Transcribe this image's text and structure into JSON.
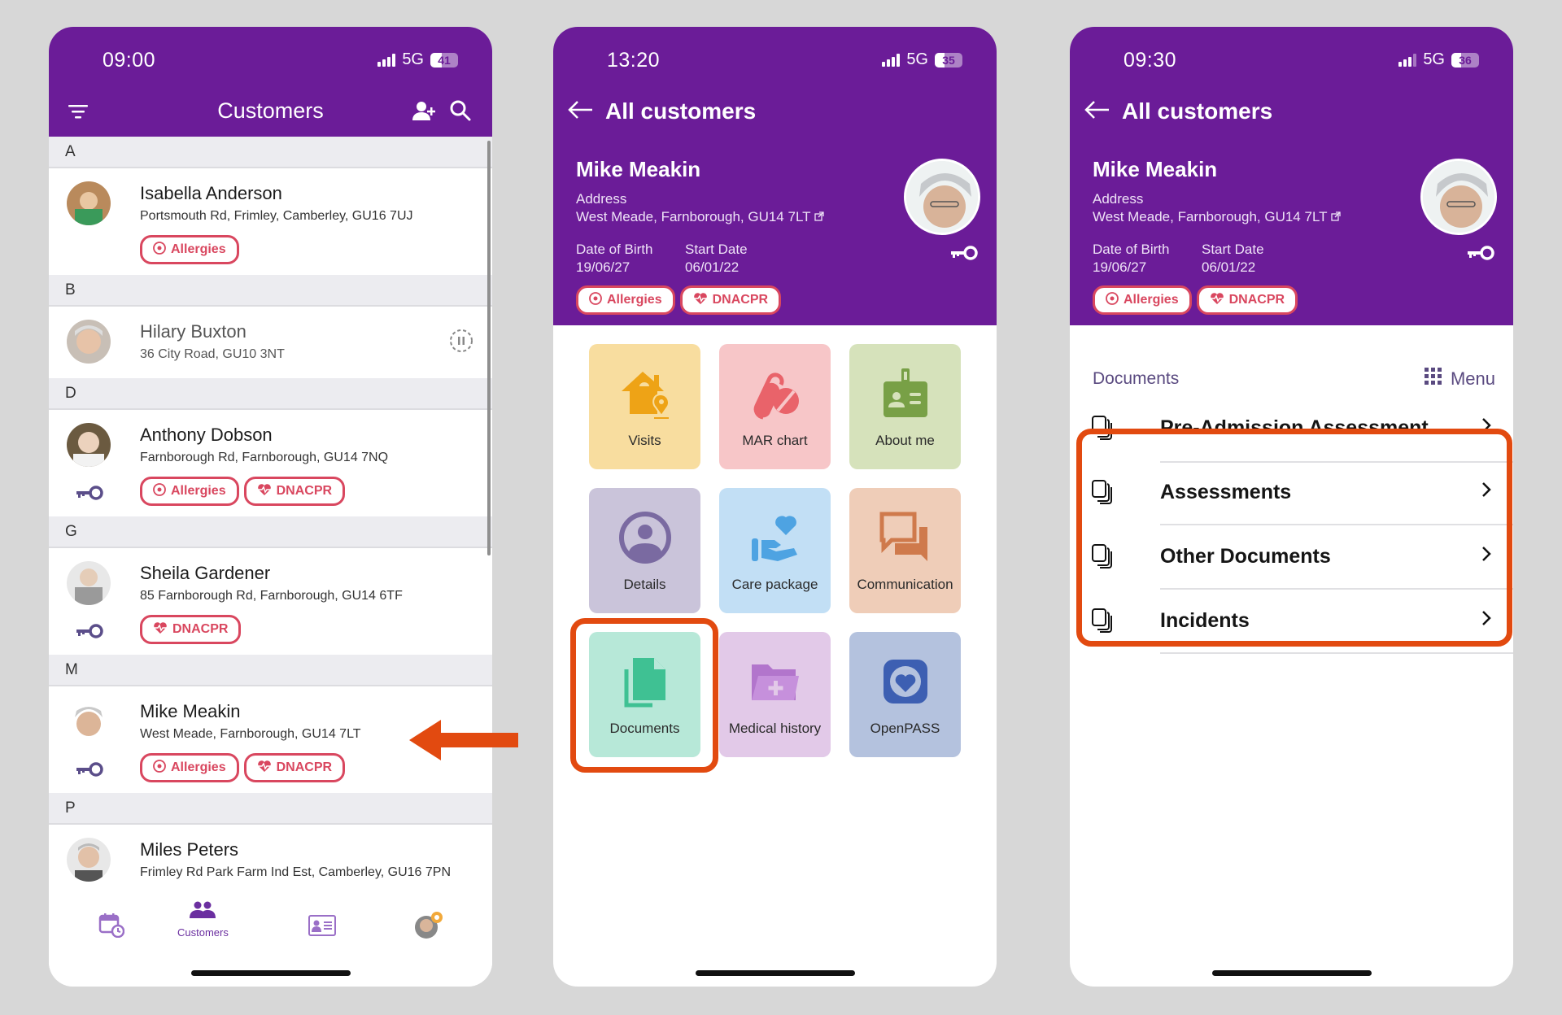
{
  "colors": {
    "brand_purple": "#6b1c98",
    "alert_red": "#d9475f",
    "annotation_orange": "#e24a10",
    "background": "#d7d7d7"
  },
  "screens": {
    "customers_list": {
      "status": {
        "time": "09:00",
        "network": "5G",
        "battery": "41",
        "battery_level": 0.41
      },
      "header": {
        "title": "Customers",
        "filter_icon": "filter-icon",
        "add_icon": "add-user-icon",
        "search_icon": "search-icon"
      },
      "sections": [
        {
          "letter": "A",
          "customers": [
            {
              "name": "Isabella Anderson",
              "address": "Portsmouth Rd, Frimley, Camberley, GU16 7UJ",
              "tags": [
                "Allergies"
              ],
              "key": false,
              "paused": false
            }
          ]
        },
        {
          "letter": "B",
          "customers": [
            {
              "name": "Hilary Buxton",
              "address": "36 City Road, GU10 3NT",
              "tags": [],
              "key": false,
              "paused": true
            }
          ]
        },
        {
          "letter": "D",
          "customers": [
            {
              "name": "Anthony Dobson",
              "address": "Farnborough Rd, Farnborough, GU14 7NQ",
              "tags": [
                "Allergies",
                "DNACPR"
              ],
              "key": true,
              "paused": false
            }
          ]
        },
        {
          "letter": "G",
          "customers": [
            {
              "name": "Sheila Gardener",
              "address": "85 Farnborough Rd, Farnborough, GU14 6TF",
              "tags": [
                "DNACPR"
              ],
              "key": true,
              "paused": false
            }
          ]
        },
        {
          "letter": "M",
          "customers": [
            {
              "name": "Mike Meakin",
              "address": "West Meade, Farnborough, GU14 7LT",
              "tags": [
                "Allergies",
                "DNACPR"
              ],
              "key": true,
              "paused": false
            }
          ]
        },
        {
          "letter": "P",
          "customers": [
            {
              "name": "Miles Peters",
              "address": "Frimley Rd Park Farm Ind Est, Camberley, GU16 7PN",
              "tags": [],
              "key": false,
              "paused": false
            }
          ]
        }
      ],
      "bottom_nav": [
        {
          "icon": "calendar-clock-icon",
          "label": "",
          "active": false
        },
        {
          "icon": "customers-icon",
          "label": "Customers",
          "active": true
        },
        {
          "icon": "id-card-icon",
          "label": "",
          "active": false
        },
        {
          "icon": "profile-avatar-icon",
          "label": "",
          "active": false
        }
      ]
    },
    "customer_menu": {
      "status": {
        "time": "13:20",
        "network": "5G",
        "battery": "35",
        "battery_level": 0.35
      },
      "back_label": "All customers",
      "profile": {
        "name": "Mike Meakin",
        "address_label": "Address",
        "address": "West Meade, Farnborough, GU14 7LT",
        "dob_label": "Date of Birth",
        "dob": "19/06/27",
        "start_label": "Start Date",
        "start": "06/01/22",
        "tags": [
          "Allergies",
          "DNACPR"
        ]
      },
      "tiles": [
        {
          "label": "Visits",
          "icon": "house-location-icon",
          "bg": "#f8dd9f",
          "fg": "#eea316"
        },
        {
          "label": "MAR chart",
          "icon": "pill-icon",
          "bg": "#f7c6c8",
          "fg": "#e9636a"
        },
        {
          "label": "About me",
          "icon": "id-badge-icon",
          "bg": "#d6e2bb",
          "fg": "#78a046"
        },
        {
          "label": "Details",
          "icon": "user-circle-icon",
          "bg": "#cac4da",
          "fg": "#7a6aa1"
        },
        {
          "label": "Care package",
          "icon": "hand-heart-icon",
          "bg": "#c2dff5",
          "fg": "#4ea3e2"
        },
        {
          "label": "Communication",
          "icon": "chat-icon",
          "bg": "#efcdb8",
          "fg": "#cf7a4c"
        },
        {
          "label": "Documents",
          "icon": "documents-icon",
          "bg": "#b7e8d8",
          "fg": "#3fc193"
        },
        {
          "label": "Medical history",
          "icon": "medical-folder-icon",
          "bg": "#e2c9e8",
          "fg": "#b275cc"
        },
        {
          "label": "OpenPASS",
          "icon": "openpass-heart-icon",
          "bg": "#b4c2de",
          "fg": "#3d5fb2"
        }
      ],
      "highlighted_tile": "Documents"
    },
    "documents": {
      "status": {
        "time": "09:30",
        "network": "5G",
        "battery": "36",
        "battery_level": 0.36
      },
      "back_label": "All customers",
      "profile": {
        "name": "Mike Meakin",
        "address_label": "Address",
        "address": "West Meade, Farnborough, GU14 7LT",
        "dob_label": "Date of Birth",
        "dob": "19/06/27",
        "start_label": "Start Date",
        "start": "06/01/22",
        "tags": [
          "Allergies",
          "DNACPR"
        ]
      },
      "section_title": "Documents",
      "menu_label": "Menu",
      "items": [
        {
          "label": "Pre-Admission Assessment"
        },
        {
          "label": "Assessments"
        },
        {
          "label": "Other Documents"
        },
        {
          "label": "Incidents"
        }
      ],
      "highlighted_items": [
        "Assessments",
        "Other Documents",
        "Incidents"
      ]
    }
  }
}
